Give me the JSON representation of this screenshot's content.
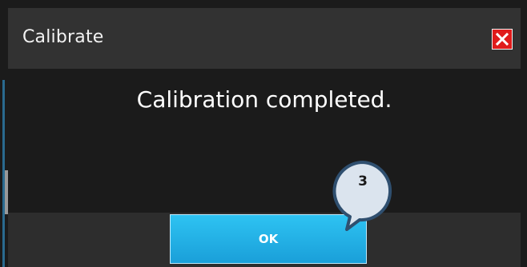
{
  "dialog": {
    "title": "Calibrate",
    "message": "Calibration completed.",
    "ok_label": "OK",
    "close_icon": "close-icon"
  },
  "annotation": {
    "step_number": "3"
  },
  "colors": {
    "titlebar_bg": "#323232",
    "content_bg": "#1b1b1b",
    "close_button": "#e01b1b",
    "ok_button": "#1fb0e6",
    "callout_fill": "#dbe4ee",
    "callout_border": "#2f4f6f"
  }
}
